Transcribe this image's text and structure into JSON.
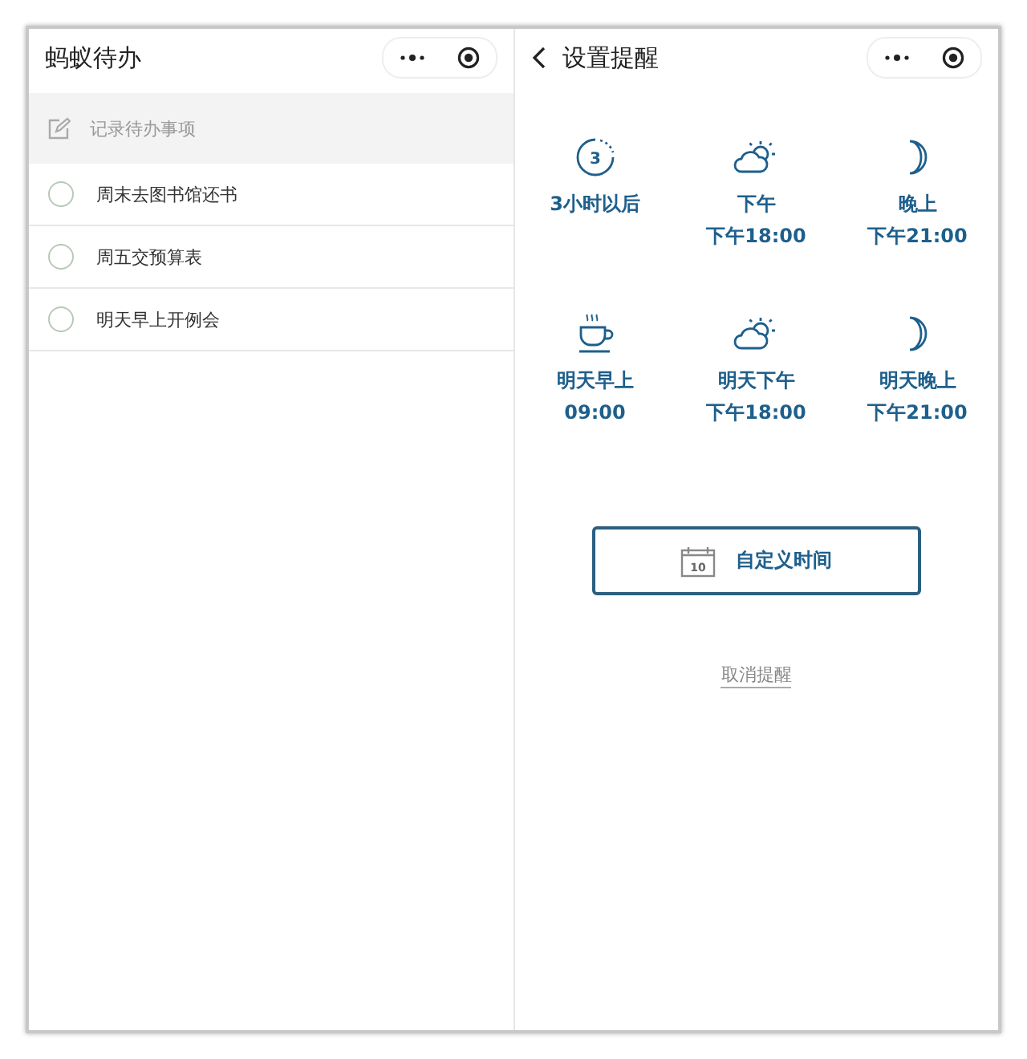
{
  "todo_screen": {
    "title": "蚂蚁待办",
    "input": {
      "placeholder": "记录待办事项"
    },
    "items": [
      {
        "text": "周末去图书馆还书",
        "checked": false
      },
      {
        "text": "周五交预算表",
        "checked": false
      },
      {
        "text": "明天早上开例会",
        "checked": false
      }
    ]
  },
  "reminder_screen": {
    "title": "设置提醒",
    "options": [
      {
        "kind": "timer",
        "icon_text": "3",
        "label": "3小时以后"
      },
      {
        "kind": "cloud",
        "label": "下午",
        "time": "下午18:00"
      },
      {
        "kind": "moon",
        "label": "晚上",
        "time": "下午21:00"
      },
      {
        "kind": "cup",
        "label": "明天早上",
        "time": "09:00"
      },
      {
        "kind": "cloud",
        "label": "明天下午",
        "time": "下午18:00"
      },
      {
        "kind": "moon",
        "label": "明天晚上",
        "time": "下午21:00"
      }
    ],
    "custom_button": {
      "calendar_day": "10",
      "label": "自定义时间"
    },
    "cancel_link": "取消提醒"
  }
}
